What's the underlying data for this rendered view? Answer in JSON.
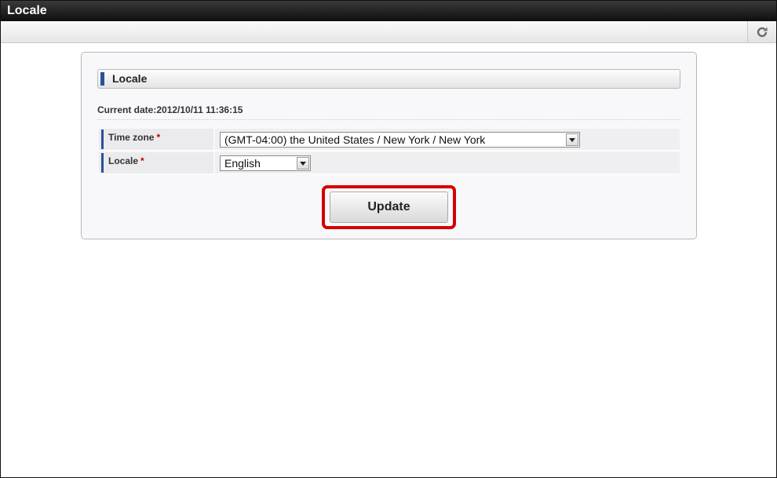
{
  "window": {
    "title": "Locale"
  },
  "toolbar": {
    "refresh_icon": "refresh-icon"
  },
  "section": {
    "title": "Locale"
  },
  "current_date": {
    "label": "Current date:",
    "value": "2012/10/11 11:36:15"
  },
  "form": {
    "timezone": {
      "label": "Time zone",
      "required_mark": "*",
      "value": "(GMT-04:00) the United States / New York / New York"
    },
    "locale": {
      "label": "Locale",
      "required_mark": "*",
      "value": "English"
    }
  },
  "actions": {
    "update_label": "Update"
  },
  "colors": {
    "accent_bar": "#2b4f9b",
    "required": "#c00000",
    "highlight": "#d40000"
  }
}
